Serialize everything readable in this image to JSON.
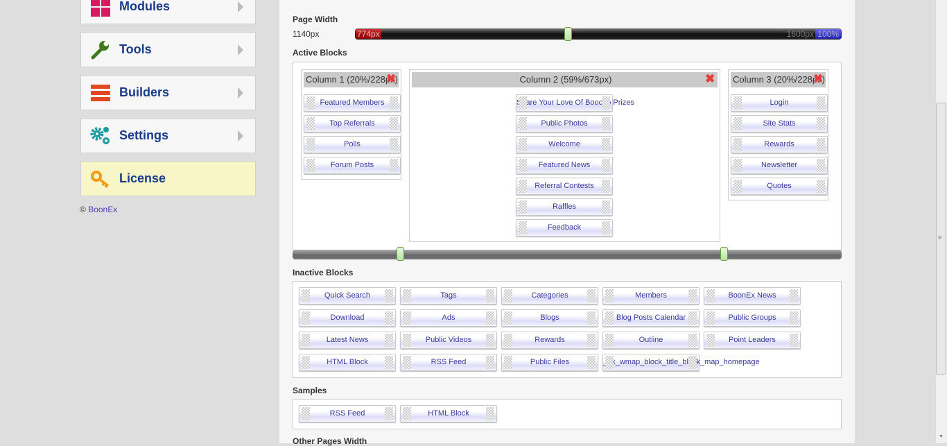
{
  "sidebar": {
    "items": [
      {
        "label": "Modules"
      },
      {
        "label": "Tools"
      },
      {
        "label": "Builders"
      },
      {
        "label": "Settings"
      },
      {
        "label": "License"
      }
    ],
    "copyright_symbol": "©",
    "copyright_link": "BoonEx"
  },
  "page_width": {
    "label": "Page Width",
    "value": "1140px",
    "min_label": "774px",
    "max_label": "1600px",
    "percent_label": "100%"
  },
  "active_blocks": {
    "label": "Active Blocks",
    "columns": [
      {
        "title": "Column 1 (20%/228px)",
        "blocks": [
          "Featured Members",
          "Top Referrals",
          "Polls",
          "Forum Posts"
        ]
      },
      {
        "title": "Column 2 (59%/673px)",
        "blocks": [
          "Share Your Love Of Boocoo Prizes",
          "Public Photos",
          "Welcome",
          "Featured News",
          "Referral Contests",
          "Raffles",
          "Feedback"
        ]
      },
      {
        "title": "Column 3 (20%/228px)",
        "blocks": [
          "Login",
          "Site Stats",
          "Rewards",
          "Newsletter",
          "Quotes"
        ]
      }
    ]
  },
  "inactive_blocks": {
    "label": "Inactive Blocks",
    "blocks": [
      "Quick Search",
      "Tags",
      "Categories",
      "Members",
      "BoonEx News",
      "Download",
      "Ads",
      "Blogs",
      "Blog Posts Calendar",
      "Public Groups",
      "Latest News",
      "Public Videos",
      "Rewards",
      "Outline",
      "Point Leaders",
      "HTML Block",
      "RSS Feed",
      "Public Files",
      "_bx_wmap_block_title_block_map_homepage"
    ]
  },
  "samples": {
    "label": "Samples",
    "blocks": [
      "RSS Feed",
      "HTML Block"
    ]
  },
  "other_pages_width": {
    "label": "Other Pages Width"
  },
  "colors": {
    "accent": "#1b3a8a",
    "block_text": "#3a3a9a",
    "license_bg": "#f8f6c6"
  }
}
